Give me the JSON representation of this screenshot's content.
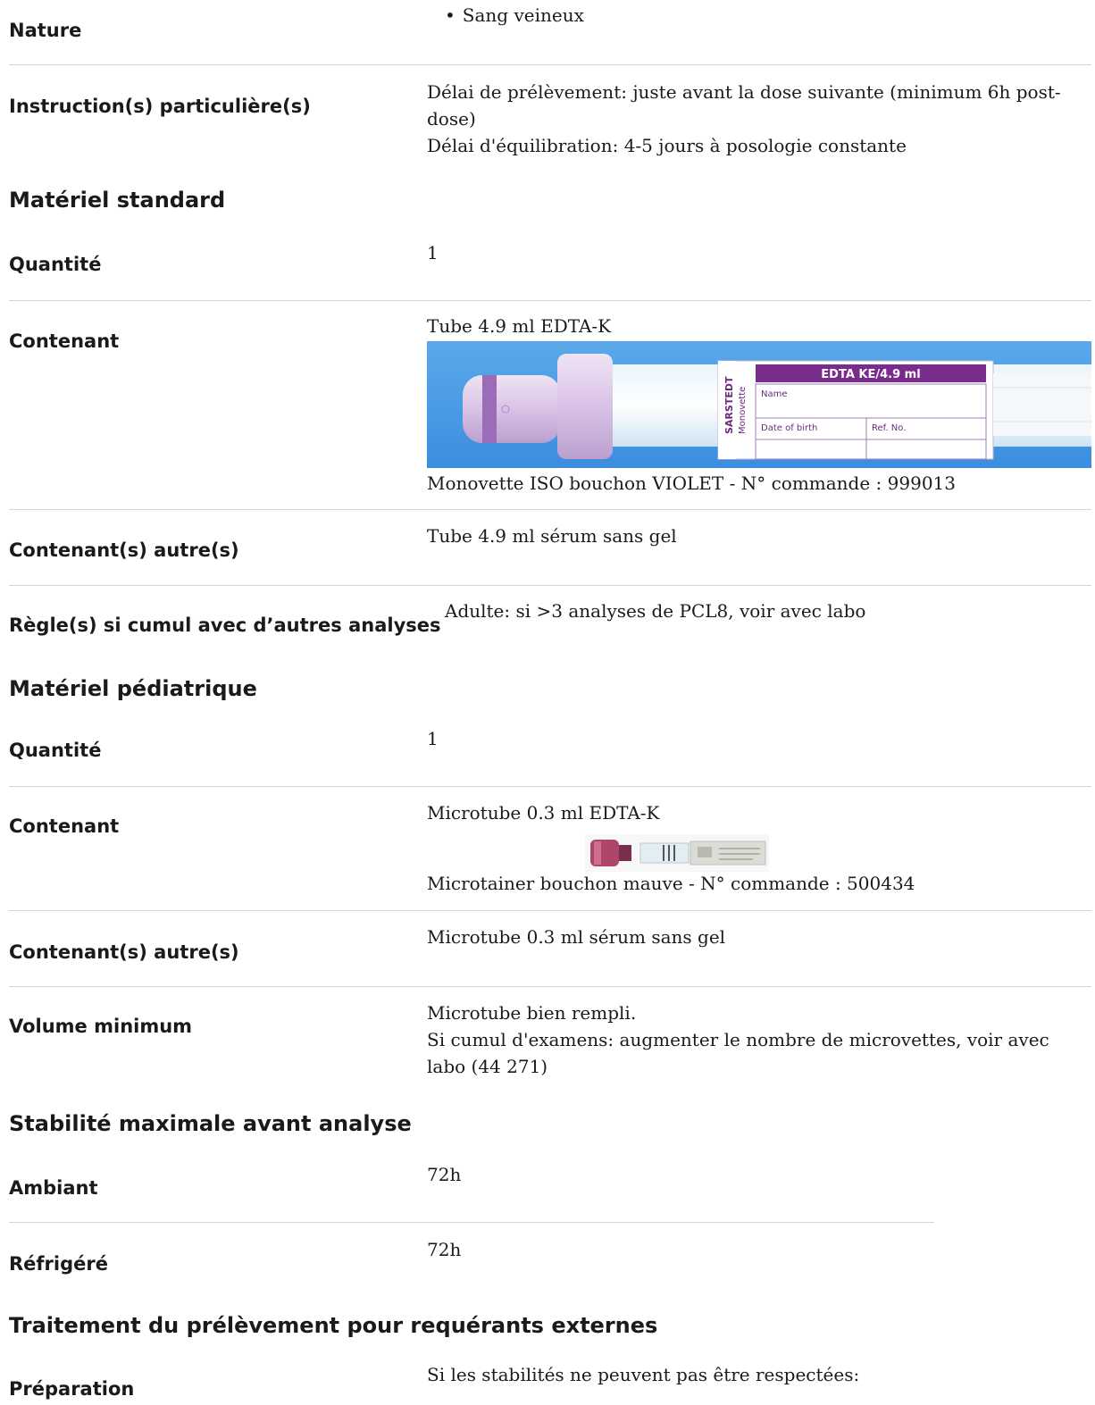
{
  "nature": {
    "label": "Nature",
    "items": [
      "Sang veineux"
    ]
  },
  "instructions": {
    "label": "Instruction(s) particulière(s)",
    "lines": [
      "Délai de prélèvement: juste avant la dose suivante (minimum 6h post-",
      "dose)",
      "Délai d'équilibration: 4-5 jours à posologie constante"
    ]
  },
  "standard": {
    "title": "Matériel standard",
    "quantity_label": "Quantité",
    "quantity_value": "1",
    "container_label": "Contenant",
    "container_value": "Tube 4.9 ml EDTA-K",
    "tube_label_text": "EDTA KE/4.9 ml",
    "tube_brand": "SARSTEDT",
    "tube_brand2": "Monovette",
    "tube_field_name": "Name",
    "tube_field_dob": "Date of birth",
    "tube_field_ref": "Ref. No.",
    "container_caption": "Monovette ISO bouchon VIOLET - N° commande : 999013",
    "other_label": "Contenant(s) autre(s)",
    "other_value": "Tube 4.9 ml sérum sans gel",
    "rules_label": "Règle(s) si cumul avec d’autres analyses",
    "rules_value": "Adulte: si >3 analyses de PCL8, voir avec labo"
  },
  "pediatric": {
    "title": "Matériel pédiatrique",
    "quantity_label": "Quantité",
    "quantity_value": "1",
    "container_label": "Contenant",
    "container_value": "Microtube 0.3 ml EDTA-K",
    "container_caption": "Microtainer bouchon mauve - N° commande : 500434",
    "other_label": "Contenant(s) autre(s)",
    "other_value": "Microtube 0.3 ml sérum sans gel",
    "volume_label": "Volume minimum",
    "volume_lines": [
      "Microtube bien rempli.",
      "Si cumul d'examens: augmenter le nombre de microvettes, voir avec",
      "labo (44 271)"
    ]
  },
  "stability": {
    "title": "Stabilité maximale avant analyse",
    "ambient_label": "Ambiant",
    "ambient_value": "72h",
    "fridge_label": "Réfrigéré",
    "fridge_value": "72h"
  },
  "treatment": {
    "title": "Traitement du prélèvement pour requérants externes",
    "prep_label": "Préparation",
    "prep_value": "Si les stabilités ne peuvent pas être respectées:"
  }
}
